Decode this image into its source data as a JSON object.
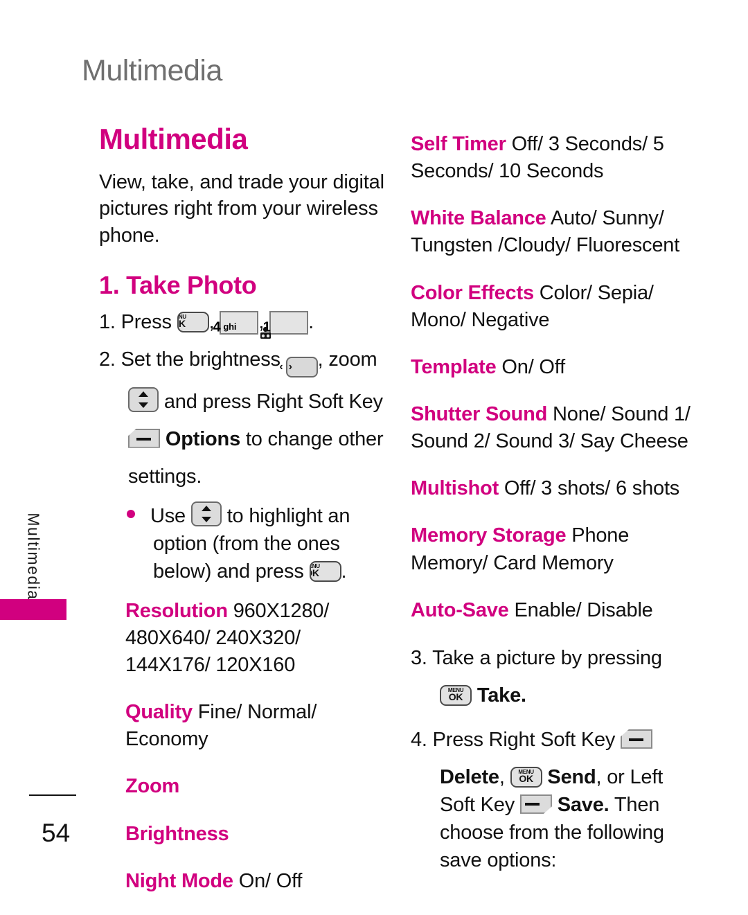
{
  "running_head": "Multimedia",
  "thumb_tab": {
    "label": "Multimedia"
  },
  "footer": {
    "page_number": "54"
  },
  "left_column": {
    "section_title": "Multimedia",
    "intro": "View, take, and trade your digital pictures right from your wireless phone.",
    "subsection_title": "1. Take Photo",
    "step1": {
      "number": "1.",
      "text_before": "Press",
      "key1": {
        "top": "MENU",
        "bottom": "OK"
      },
      "sep1": ",",
      "key2": {
        "digit": "4",
        "letters": "ghi"
      },
      "sep2": ",",
      "key3": {
        "digit": "1",
        "icon": "voicemail-icon"
      },
      "end": "."
    },
    "step2": {
      "number": "2.",
      "part1": "Set the brightness",
      "key_leftright": "left-right-nav-key",
      "part2": ", zoom",
      "key_updown": "up-down-nav-key",
      "part3": "and press Right Soft Key",
      "key_rightsoft": "right-soft-key",
      "part4_bold": "Options",
      "part5": "to change other",
      "part6": "settings."
    },
    "bullet1": {
      "part1": "Use",
      "key_updown": "up-down-nav-key",
      "part2": "to highlight an option (from the ones below) and press",
      "key_menuok": {
        "top": "MENU",
        "bottom": "OK"
      },
      "end": "."
    },
    "options": [
      {
        "label": "Resolution",
        "value": "960X1280/ 480X640/ 240X320/ 144X176/ 120X160"
      },
      {
        "label": "Quality",
        "value": "Fine/ Normal/ Economy"
      },
      {
        "label": "Zoom",
        "value": ""
      },
      {
        "label": "Brightness",
        "value": ""
      },
      {
        "label": "Night Mode",
        "value": "On/ Off"
      }
    ]
  },
  "right_column": {
    "options": [
      {
        "label": "Self Timer",
        "value": "Off/ 3 Seconds/ 5 Seconds/ 10 Seconds"
      },
      {
        "label": "White Balance",
        "value": "Auto/ Sunny/ Tungsten /Cloudy/ Fluorescent"
      },
      {
        "label": "Color Effects",
        "value": "Color/ Sepia/ Mono/ Negative"
      },
      {
        "label": "Template",
        "value": "On/ Off"
      },
      {
        "label": "Shutter Sound",
        "value": "None/ Sound 1/ Sound 2/ Sound 3/ Say Cheese"
      },
      {
        "label": "Multishot",
        "value": "Off/ 3 shots/ 6 shots"
      },
      {
        "label": "Memory Storage",
        "value": "Phone Memory/ Card Memory"
      },
      {
        "label": "Auto-Save",
        "value": "Enable/ Disable"
      }
    ],
    "step3": {
      "number": "3.",
      "part1": "Take a picture by pressing",
      "key_menuok": {
        "top": "MENU",
        "bottom": "OK"
      },
      "part2_bold": "Take."
    },
    "step4": {
      "number": "4.",
      "part1": "Press Right Soft Key",
      "key_rightsoft": "right-soft-key",
      "part2_bold": "Delete",
      "part3": ",",
      "key_menuok": {
        "top": "MENU",
        "bottom": "OK"
      },
      "part4_bold": "Send",
      "part5": ", or Left Soft Key",
      "key_leftsoft": "left-soft-key",
      "part6_bold": "Save.",
      "part7": "Then choose from the following save options:"
    }
  },
  "colors": {
    "accent_magenta": "#d1007f",
    "running_head_gray": "#6f6f6f",
    "body_black": "#111111"
  }
}
